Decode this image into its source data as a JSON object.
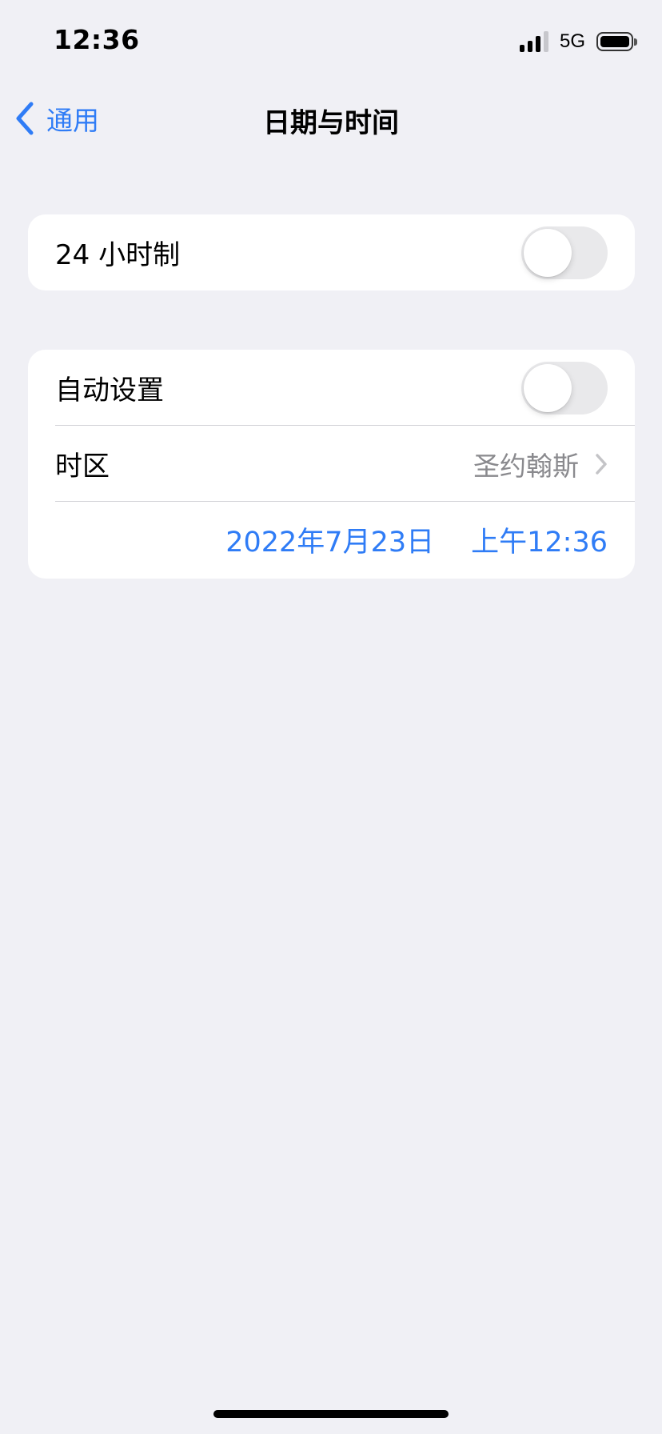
{
  "status_bar": {
    "time": "12:36",
    "network": "5G",
    "signal_icon": "cellular-signal-icon",
    "battery_icon": "battery-icon"
  },
  "nav": {
    "back_label": "通用",
    "back_icon": "chevron-left-icon",
    "title": "日期与时间"
  },
  "settings": {
    "hour24": {
      "label": "24 小时制",
      "enabled": false
    },
    "auto_set": {
      "label": "自动设置",
      "enabled": false
    },
    "timezone": {
      "label": "时区",
      "value": "圣约翰斯",
      "icon": "chevron-right-icon"
    },
    "date_value": "2022年7月23日",
    "time_value": "上午12:36"
  },
  "colors": {
    "accent": "#2f7cf6",
    "background": "#f0f0f5",
    "secondary_text": "#8a8a8e",
    "toggle_off": "#e9e9eb"
  }
}
